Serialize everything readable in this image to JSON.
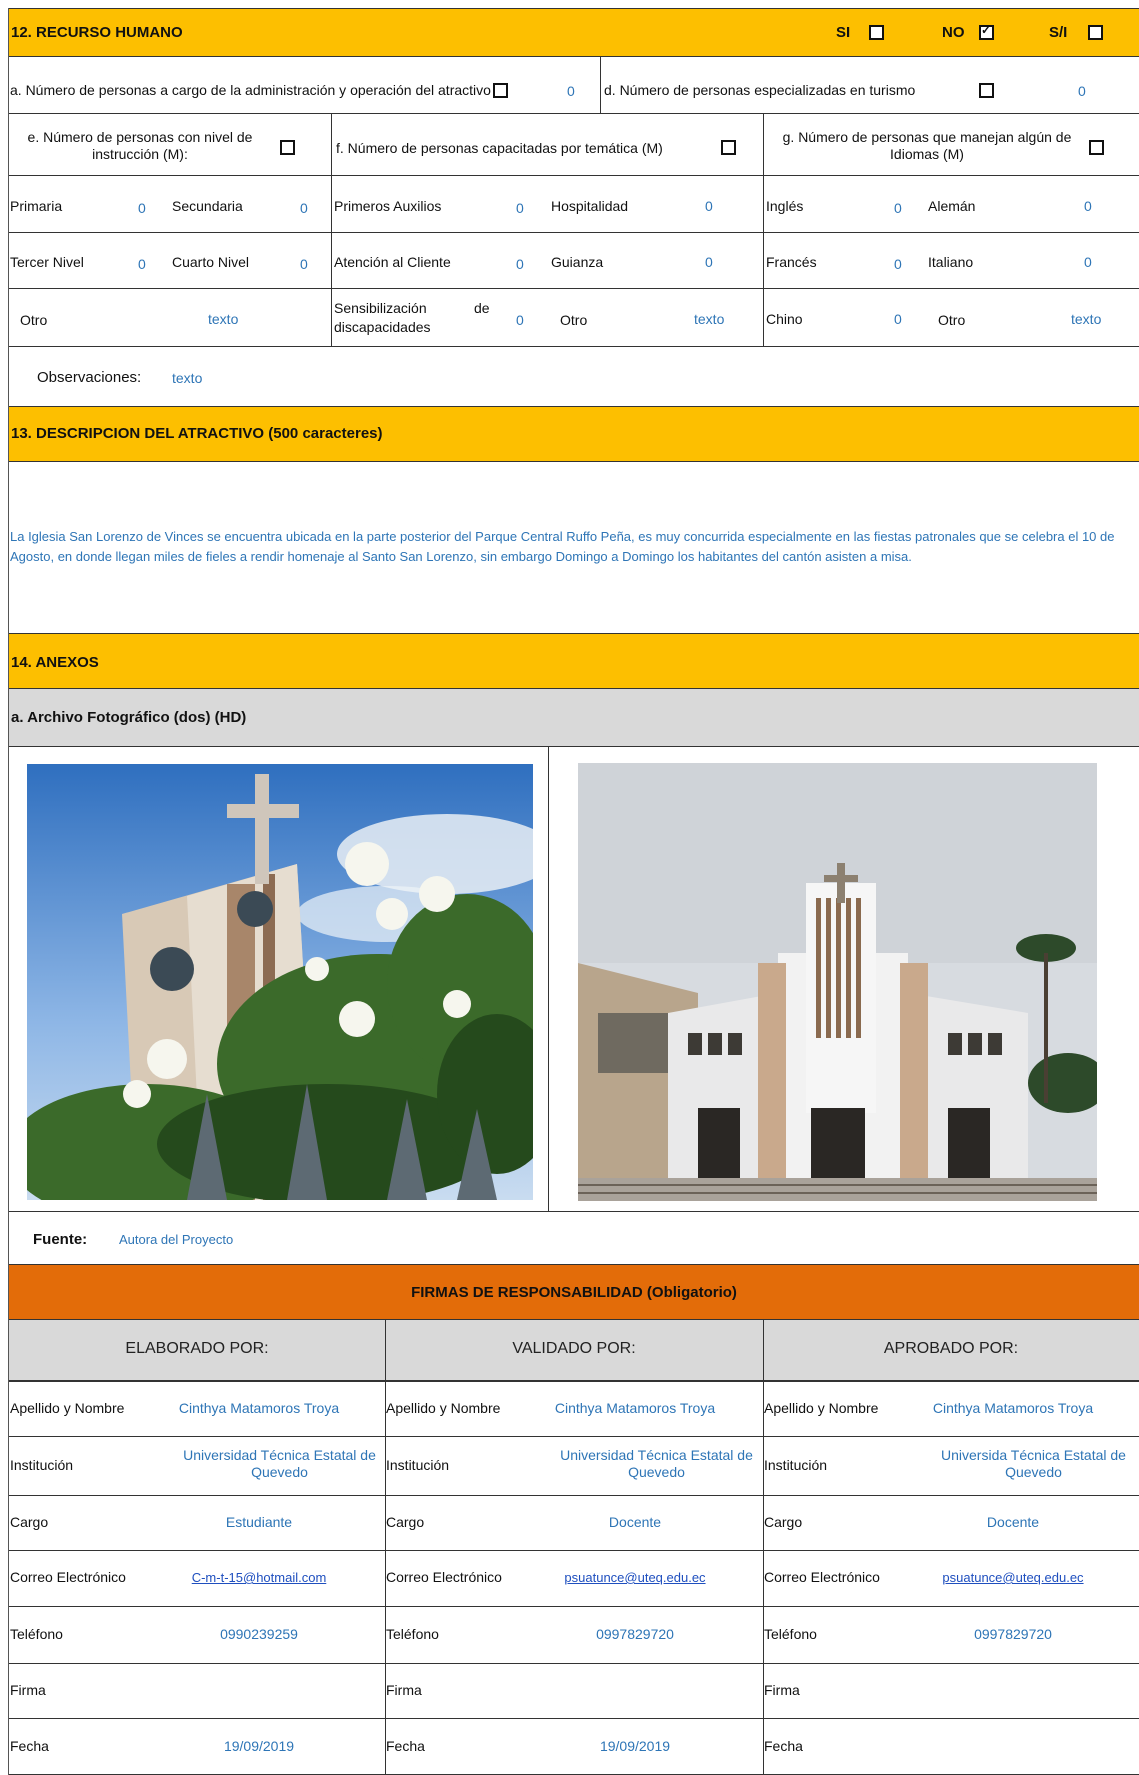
{
  "colors": {
    "section_band": "#fdbf00",
    "signature_band": "#e36c09",
    "header_gray": "#d9d9d9",
    "value_text": "#2e75b6"
  },
  "s12": {
    "title": "12. RECURSO HUMANO",
    "opt_si": "SI",
    "opt_no": "NO",
    "opt_si_checked": false,
    "opt_no_checked": true,
    "opt_sin": "S/I",
    "opt_sin_checked": false,
    "a_label": "a. Número de personas a cargo de la administración y operación del atractivo",
    "a_value": "0",
    "d_label": "d. Número de personas especializadas en turismo",
    "d_value": "0",
    "e_label": "e. Número de personas con nivel de instrucción (M):",
    "f_label": "f. Número de personas capacitadas por temática (M)",
    "g_label": "g. Número de personas que manejan algún de Idiomas (M)",
    "primaria": "Primaria",
    "primaria_v": "0",
    "secundaria": "Secundaria",
    "secundaria_v": "0",
    "tercer": "Tercer Nivel",
    "tercer_v": "0",
    "cuarto": "Cuarto Nivel",
    "cuarto_v": "0",
    "otro1": "Otro",
    "otro1_v": "texto",
    "auxilios": "Primeros Auxilios",
    "auxilios_v": "0",
    "hospitalidad": "Hospitalidad",
    "hospitalidad_v": "0",
    "atencion": "Atención al Cliente",
    "atencion_v": "0",
    "guianza": "Guianza",
    "guianza_v": "0",
    "sensib_a": "Sensibilización",
    "sensib_de": "de",
    "sensib_b": "discapacidades",
    "sensib_v": "0",
    "otro2": "Otro",
    "otro2_v": "texto",
    "ingles": "Inglés",
    "ingles_v": "0",
    "aleman": "Alemán",
    "aleman_v": "0",
    "frances": "Francés",
    "frances_v": "0",
    "italiano": "Italiano",
    "italiano_v": "0",
    "chino": "Chino",
    "chino_v": "0",
    "otro3": "Otro",
    "otro3_v": "texto",
    "obs_label": "Observaciones:",
    "obs_value": "texto"
  },
  "s13": {
    "title": "13. DESCRIPCION DEL ATRACTIVO (500 caracteres)",
    "text": "La Iglesia San Lorenzo de Vinces se encuentra ubicada en la parte posterior del Parque Central Ruffo Peña, es muy concurrida especialmente en las fiestas patronales que se celebra el 10 de Agosto, en donde llegan miles de fieles a rendir homenaje al Santo San Lorenzo, sin embargo Domingo  a Domingo los habitantes del cantón asisten a misa."
  },
  "s14": {
    "title": "14. ANEXOS",
    "sub": "a. Archivo Fotográfico (dos) (HD)",
    "fuente_label": "Fuente:",
    "fuente_value": "Autora del Proyecto"
  },
  "firmas": {
    "title": "FIRMAS DE RESPONSABILIDAD (Obligatorio)",
    "cols": [
      {
        "header": "ELABORADO POR:",
        "nombre": "Cinthya Matamoros Troya",
        "institucion": "Universidad Técnica Estatal de Quevedo",
        "cargo": "Estudiante",
        "correo": "C-m-t-15@hotmail.com",
        "telefono": "0990239259",
        "firma": "",
        "fecha": "19/09/2019"
      },
      {
        "header": "VALIDADO  POR:",
        "nombre": "Cinthya Matamoros Troya",
        "institucion": "Universidad Técnica Estatal de Quevedo",
        "cargo": "Docente",
        "correo": "psuatunce@uteq.edu.ec",
        "telefono": "0997829720",
        "firma": "",
        "fecha": "19/09/2019"
      },
      {
        "header": "APROBADO POR:",
        "nombre": "Cinthya Matamoros Troya",
        "institucion": "Universida Técnica Estatal de Quevedo",
        "cargo": "Docente",
        "correo": "psuatunce@uteq.edu.ec",
        "telefono": "0997829720",
        "firma": "",
        "fecha": ""
      }
    ],
    "labels": {
      "nombre": "Apellido y Nombre",
      "institucion": "Institución",
      "cargo": "Cargo",
      "correo": "Correo Electrónico",
      "telefono": "Teléfono",
      "firma": "Firma",
      "fecha": "Fecha"
    }
  }
}
